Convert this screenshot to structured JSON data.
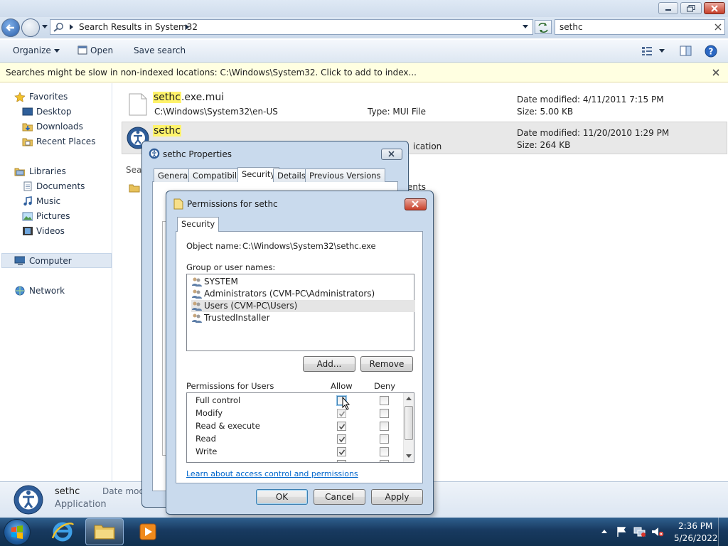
{
  "explorer": {
    "address": "Search Results in System32",
    "search_value": "sethc",
    "toolbar": {
      "organize": "Organize",
      "open": "Open",
      "save_search": "Save search"
    },
    "infobar": "Searches might be slow in non-indexed locations: C:\\Windows\\System32. Click to add to index...",
    "nav": {
      "favorites": "Favorites",
      "desktop": "Desktop",
      "downloads": "Downloads",
      "recent_places": "Recent Places",
      "libraries": "Libraries",
      "documents": "Documents",
      "music": "Music",
      "pictures": "Pictures",
      "videos": "Videos",
      "computer": "Computer",
      "network": "Network"
    },
    "results": [
      {
        "name_hl": "sethc",
        "name_rest": ".exe.mui",
        "path": "C:\\Windows\\System32\\en-US",
        "type": "Type: MUI File",
        "date": "Date modified: 4/11/2011 7:15 PM",
        "size": "Size: 5.00 KB"
      },
      {
        "name_hl": "sethc",
        "name_rest": "",
        "type_partial": "ication",
        "date": "Date modified: 11/20/2010 1:29 PM",
        "size": "Size: 264 KB"
      }
    ],
    "partial_search_again": "Sear",
    "partial_ents": "ents",
    "details": {
      "name": "sethc",
      "kind": "Application",
      "date_partial": "Date modi"
    }
  },
  "properties_dialog": {
    "title": "sethc Properties",
    "tabs": [
      "General",
      "Compatibility",
      "Security",
      "Details",
      "Previous Versions"
    ],
    "selected_tab": "Security"
  },
  "permissions_dialog": {
    "title": "Permissions for sethc",
    "tab": "Security",
    "object_label": "Object name:",
    "object_value": "C:\\Windows\\System32\\sethc.exe",
    "group_label": "Group or user names:",
    "users": [
      "SYSTEM",
      "Administrators (CVM-PC\\Administrators)",
      "Users (CVM-PC\\Users)",
      "TrustedInstaller"
    ],
    "selected_user": "Users (CVM-PC\\Users)",
    "add_button": "Add...",
    "remove_button": "Remove",
    "perm_label": "Permissions for Users",
    "allow_header": "Allow",
    "deny_header": "Deny",
    "permissions": [
      {
        "name": "Full control",
        "allow": false,
        "deny": false
      },
      {
        "name": "Modify",
        "allow": true,
        "deny": false
      },
      {
        "name": "Read & execute",
        "allow": true,
        "deny": false
      },
      {
        "name": "Read",
        "allow": true,
        "deny": false
      },
      {
        "name": "Write",
        "allow": true,
        "deny": false
      }
    ],
    "link": "Learn about access control and permissions",
    "ok": "OK",
    "cancel": "Cancel",
    "apply": "Apply"
  },
  "taskbar": {
    "time": "2:36 PM",
    "date": "5/26/2022"
  },
  "colors": {
    "highlight": "#fff36b",
    "infobar": "#ffffe1",
    "taskbar": "#183a60",
    "link": "#0066cc"
  }
}
